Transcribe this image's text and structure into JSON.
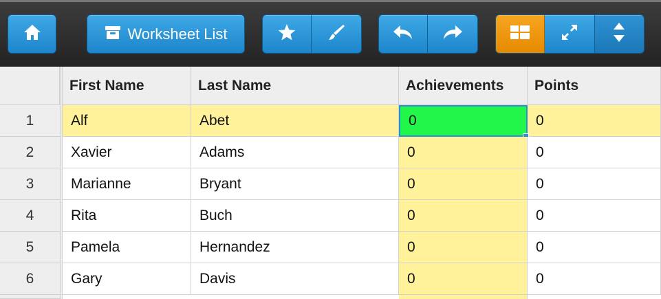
{
  "toolbar": {
    "home_icon": "home-icon",
    "worksheet_list_label": "Worksheet List",
    "worksheet_icon": "archive-box-icon",
    "star_icon": "star-icon",
    "brush_icon": "brush-icon",
    "undo_icon": "undo-icon",
    "redo_icon": "redo-icon",
    "grid_view_icon": "grid-view-icon",
    "expand_icon": "expand-icon",
    "sort_icon": "sort-updown-icon",
    "accent_color": "#f39a12",
    "button_color": "#2d97db"
  },
  "grid": {
    "headers": [
      "First Name",
      "Last Name",
      "Achievements",
      "Points"
    ],
    "rows": [
      {
        "num": "1",
        "first": "Alf",
        "last": "Abet",
        "achievements": "0",
        "points": "0"
      },
      {
        "num": "2",
        "first": "Xavier",
        "last": "Adams",
        "achievements": "0",
        "points": "0"
      },
      {
        "num": "3",
        "first": "Marianne",
        "last": "Bryant",
        "achievements": "0",
        "points": "0"
      },
      {
        "num": "4",
        "first": "Rita",
        "last": "Buch",
        "achievements": "0",
        "points": "0"
      },
      {
        "num": "5",
        "first": "Pamela",
        "last": "Hernandez",
        "achievements": "0",
        "points": "0"
      },
      {
        "num": "6",
        "first": "Gary",
        "last": "Davis",
        "achievements": "0",
        "points": "0"
      }
    ],
    "highlight_color": "#fff29a",
    "selected_color": "#22f64a"
  }
}
